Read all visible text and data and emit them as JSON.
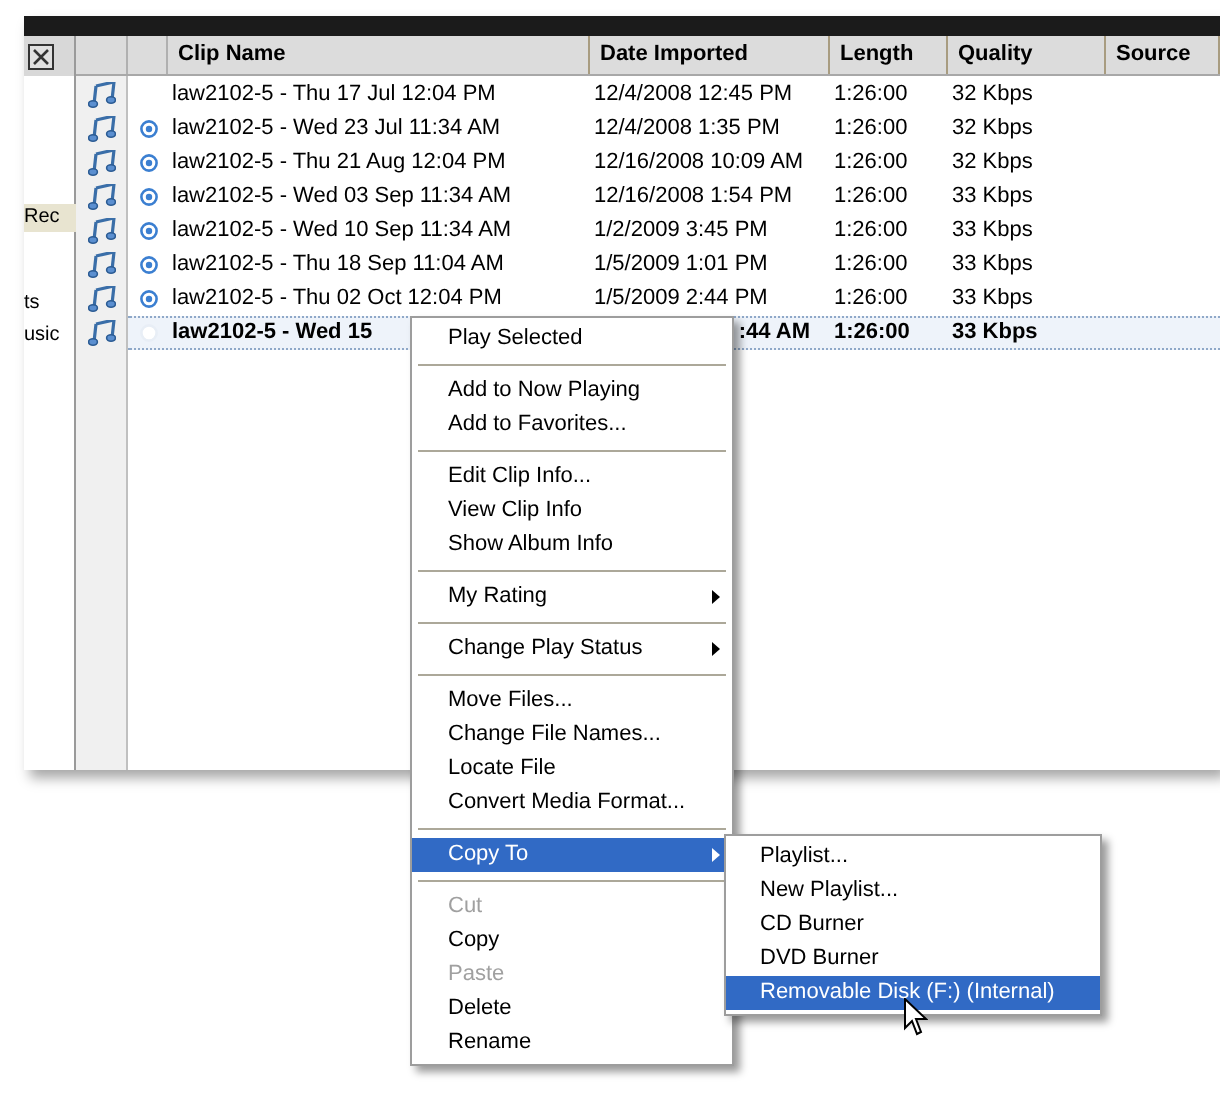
{
  "sidebar": {
    "items": [
      {
        "label": "Rec",
        "selected": true
      },
      {
        "label": "ts",
        "selected": false
      },
      {
        "label": "usic",
        "selected": false
      }
    ]
  },
  "table": {
    "columns": [
      "Clip Name",
      "Date Imported",
      "Length",
      "Quality",
      "Source"
    ],
    "rows": [
      {
        "marker": false,
        "selected": false,
        "cells": [
          "law2102-5 - Thu 17 Jul 12:04 PM",
          "12/4/2008 12:45 PM",
          "1:26:00",
          "32 Kbps"
        ]
      },
      {
        "marker": true,
        "selected": false,
        "cells": [
          "law2102-5 - Wed 23 Jul 11:34 AM",
          "12/4/2008 1:35 PM",
          "1:26:00",
          "32 Kbps"
        ]
      },
      {
        "marker": true,
        "selected": false,
        "cells": [
          "law2102-5 - Thu 21 Aug 12:04 PM",
          "12/16/2008 10:09 AM",
          "1:26:00",
          "32 Kbps"
        ]
      },
      {
        "marker": true,
        "selected": false,
        "cells": [
          "law2102-5 - Wed 03 Sep 11:34 AM",
          "12/16/2008 1:54 PM",
          "1:26:00",
          "33 Kbps"
        ]
      },
      {
        "marker": true,
        "selected": false,
        "cells": [
          "law2102-5 - Wed 10 Sep 11:34 AM",
          "1/2/2009 3:45 PM",
          "1:26:00",
          "33 Kbps"
        ]
      },
      {
        "marker": true,
        "selected": false,
        "cells": [
          "law2102-5 - Thu 18 Sep 11:04 AM",
          "1/5/2009 1:01 PM",
          "1:26:00",
          "33 Kbps"
        ]
      },
      {
        "marker": true,
        "selected": false,
        "cells": [
          "law2102-5 - Thu 02 Oct 12:04 PM",
          "1/5/2009 2:44 PM",
          "1:26:00",
          "33 Kbps"
        ]
      },
      {
        "marker": true,
        "selected": true,
        "cells": [
          "law2102-5 - Wed 15",
          ":44 AM",
          "1:26:00",
          "33 Kbps"
        ]
      }
    ]
  },
  "context_menu": {
    "groups": [
      [
        {
          "label": "Play Selected",
          "disabled": false,
          "submenu": false,
          "selected": false
        }
      ],
      [
        {
          "label": "Add to Now Playing",
          "disabled": false,
          "submenu": false,
          "selected": false
        },
        {
          "label": "Add to Favorites...",
          "disabled": false,
          "submenu": false,
          "selected": false
        }
      ],
      [
        {
          "label": "Edit Clip Info...",
          "disabled": false,
          "submenu": false,
          "selected": false
        },
        {
          "label": "View Clip Info",
          "disabled": false,
          "submenu": false,
          "selected": false
        },
        {
          "label": "Show Album Info",
          "disabled": false,
          "submenu": false,
          "selected": false
        }
      ],
      [
        {
          "label": "My Rating",
          "disabled": false,
          "submenu": true,
          "selected": false
        }
      ],
      [
        {
          "label": "Change Play Status",
          "disabled": false,
          "submenu": true,
          "selected": false
        }
      ],
      [
        {
          "label": "Move Files...",
          "disabled": false,
          "submenu": false,
          "selected": false
        },
        {
          "label": "Change File Names...",
          "disabled": false,
          "submenu": false,
          "selected": false
        },
        {
          "label": "Locate File",
          "disabled": false,
          "submenu": false,
          "selected": false
        },
        {
          "label": "Convert Media Format...",
          "disabled": false,
          "submenu": false,
          "selected": false
        }
      ],
      [
        {
          "label": "Copy To",
          "disabled": false,
          "submenu": true,
          "selected": true
        }
      ],
      [
        {
          "label": "Cut",
          "disabled": true,
          "submenu": false,
          "selected": false
        },
        {
          "label": "Copy",
          "disabled": false,
          "submenu": false,
          "selected": false
        },
        {
          "label": "Paste",
          "disabled": true,
          "submenu": false,
          "selected": false
        },
        {
          "label": "Delete",
          "disabled": false,
          "submenu": false,
          "selected": false
        },
        {
          "label": "Rename",
          "disabled": false,
          "submenu": false,
          "selected": false
        }
      ]
    ]
  },
  "submenu": {
    "items": [
      {
        "label": "Playlist...",
        "selected": false
      },
      {
        "label": "New Playlist...",
        "selected": false
      },
      {
        "label": "CD Burner",
        "selected": false
      },
      {
        "label": "DVD Burner",
        "selected": false
      },
      {
        "label": "Removable Disk (F:) (Internal)",
        "selected": true
      }
    ]
  }
}
